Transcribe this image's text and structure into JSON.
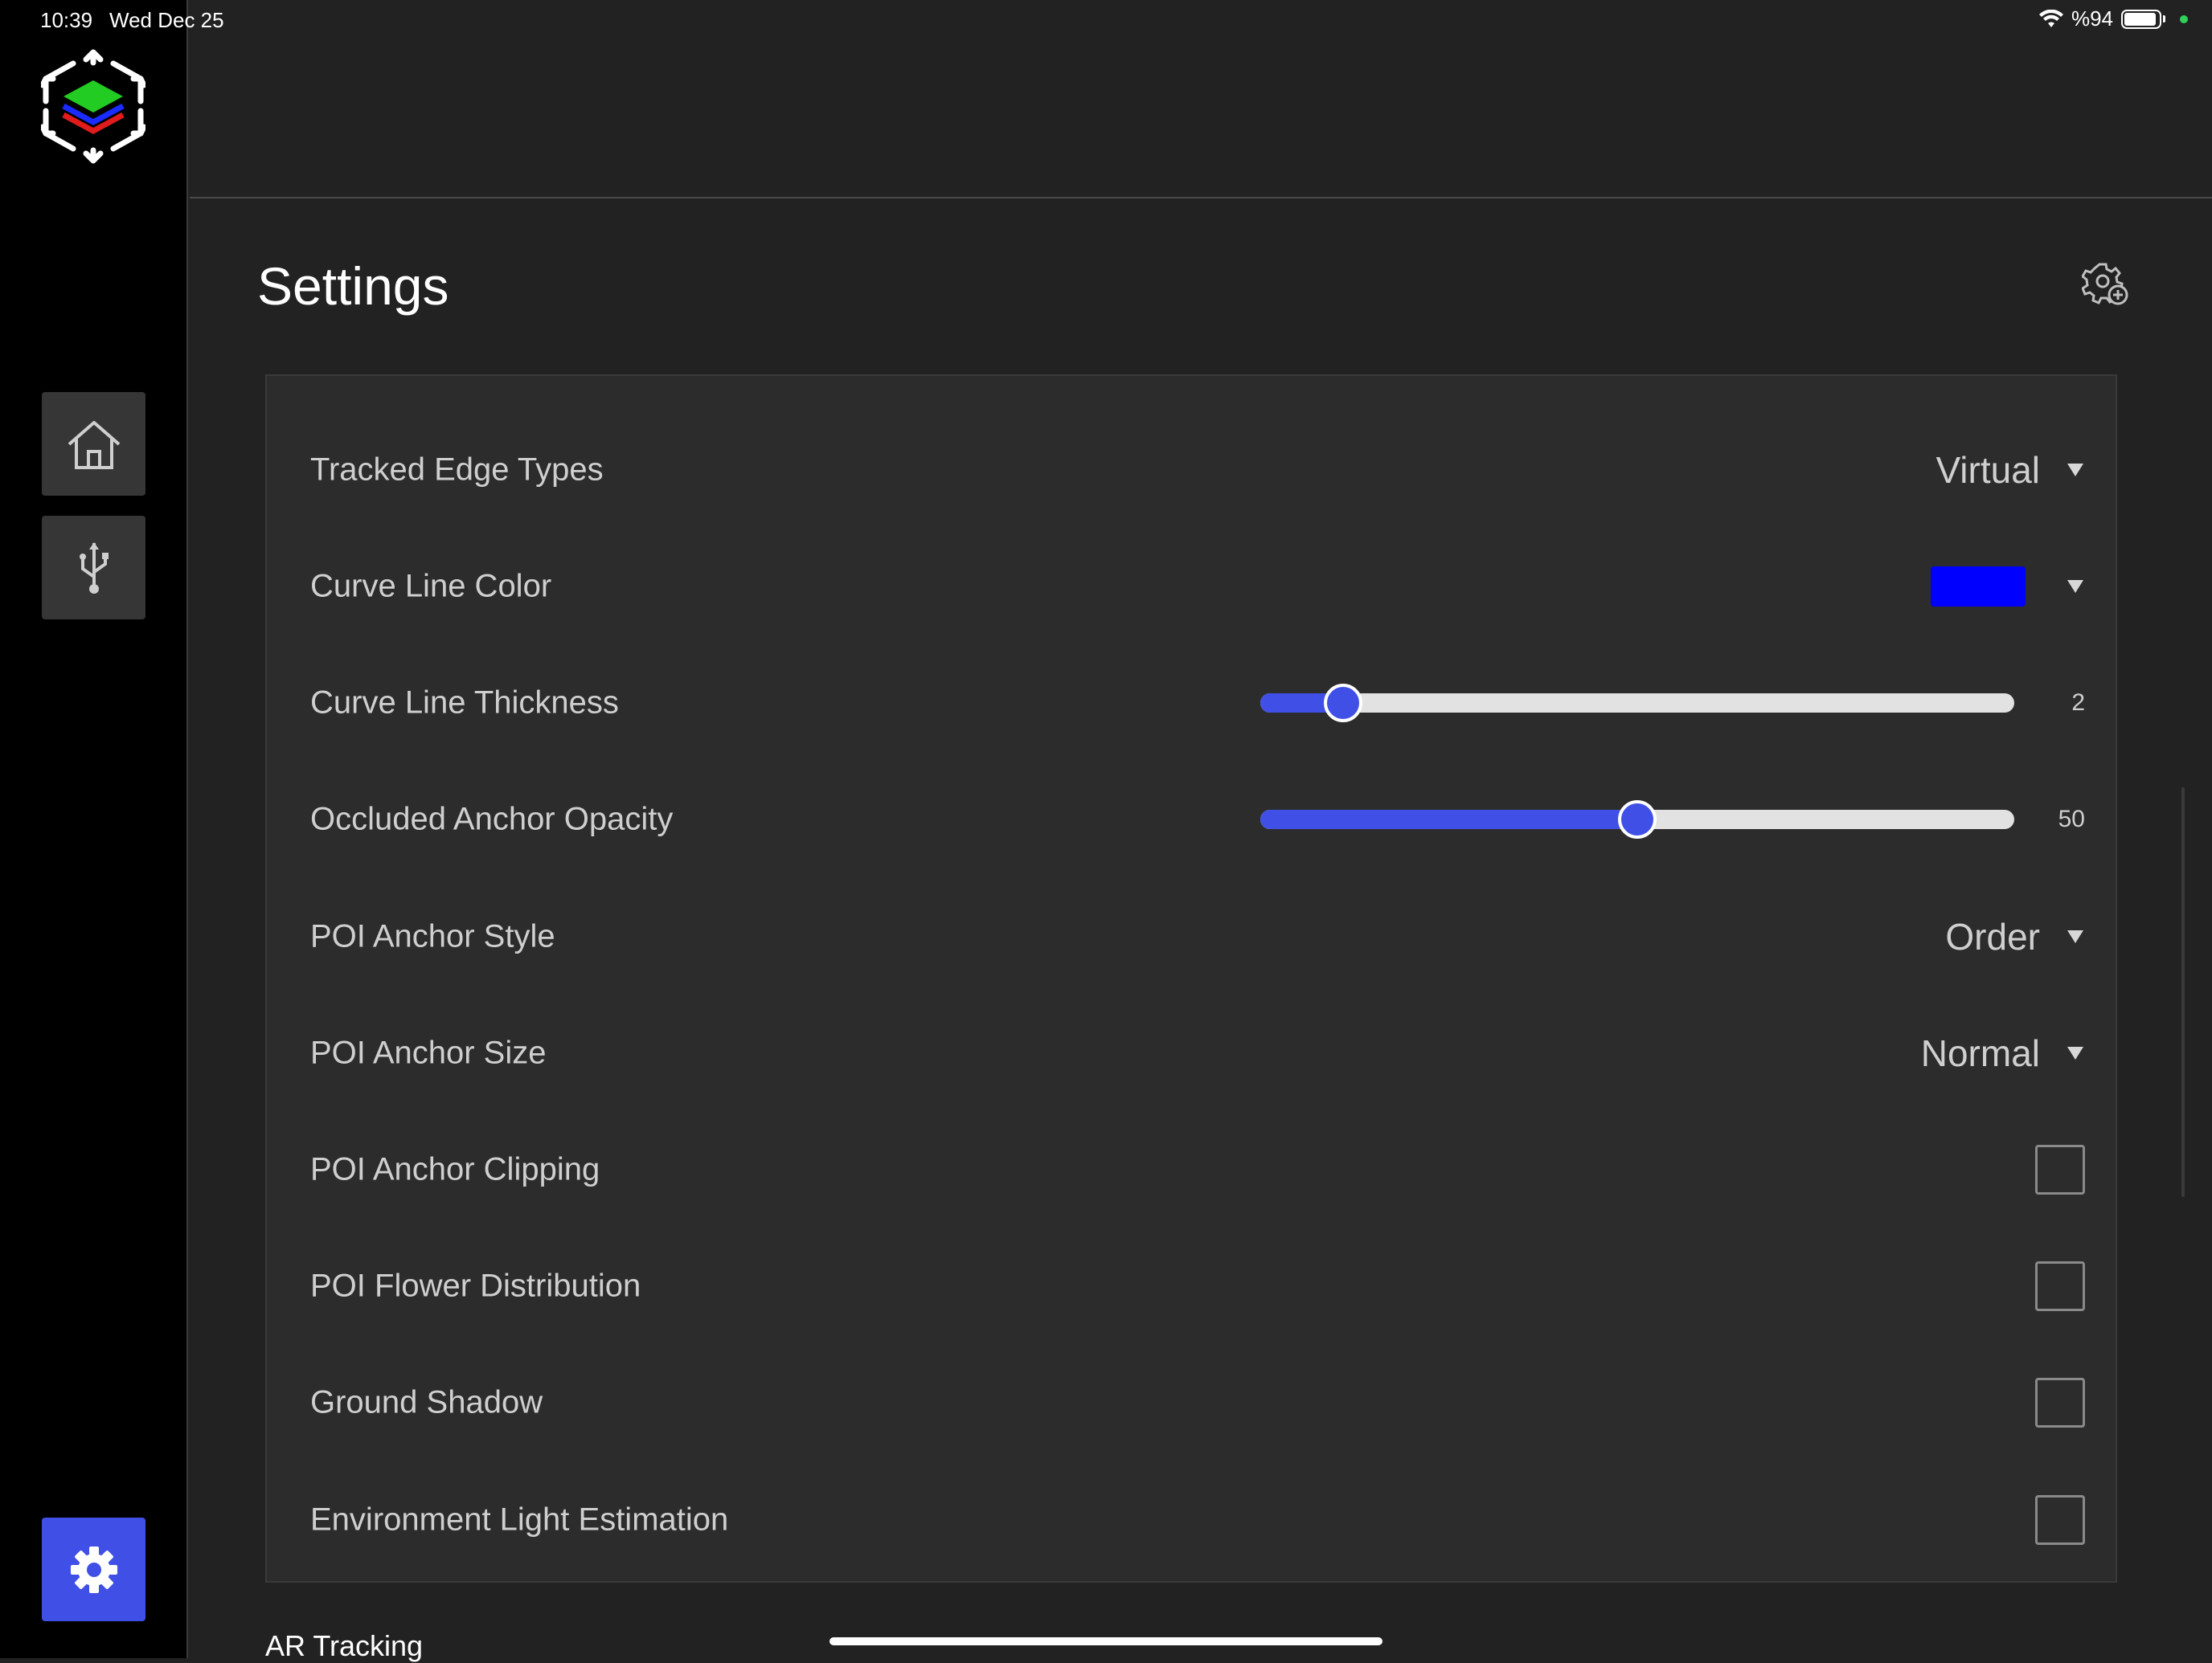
{
  "status_bar": {
    "time": "10:39",
    "date": "Wed Dec 25",
    "battery_text": "%94",
    "battery_percent": 94,
    "wifi_icon": "wifi-icon",
    "indicator_color": "#30d158"
  },
  "sidebar": {
    "logo_colors": {
      "top": "#22cc22",
      "middle": "#1a2bff",
      "bottom": "#e01b1b"
    },
    "items": [
      {
        "icon": "home-icon"
      },
      {
        "icon": "usb-icon"
      },
      {
        "icon": "gear-icon",
        "active": true
      }
    ]
  },
  "header": {
    "title": "Settings",
    "action_icon": "settings-add-icon"
  },
  "settings": {
    "tracked_edge_types": {
      "label": "Tracked Edge Types",
      "value": "Virtual"
    },
    "curve_line_color": {
      "label": "Curve Line Color",
      "color": "#0000ff"
    },
    "curve_line_thickness": {
      "label": "Curve Line Thickness",
      "value": "2",
      "fraction": 0.11
    },
    "occluded_anchor_opacity": {
      "label": "Occluded Anchor Opacity",
      "value": "50",
      "fraction": 0.5
    },
    "poi_anchor_style": {
      "label": "POI Anchor Style",
      "value": "Order"
    },
    "poi_anchor_size": {
      "label": "POI Anchor Size",
      "value": "Normal"
    },
    "poi_anchor_clipping": {
      "label": "POI Anchor Clipping",
      "checked": false
    },
    "poi_flower_distribution": {
      "label": "POI Flower Distribution",
      "checked": false
    },
    "ground_shadow": {
      "label": "Ground Shadow",
      "checked": false
    },
    "environment_light_estimation": {
      "label": "Environment Light Estimation",
      "checked": false
    }
  },
  "next_section": {
    "title": "AR Tracking"
  },
  "colors": {
    "accent": "#4050e6"
  }
}
